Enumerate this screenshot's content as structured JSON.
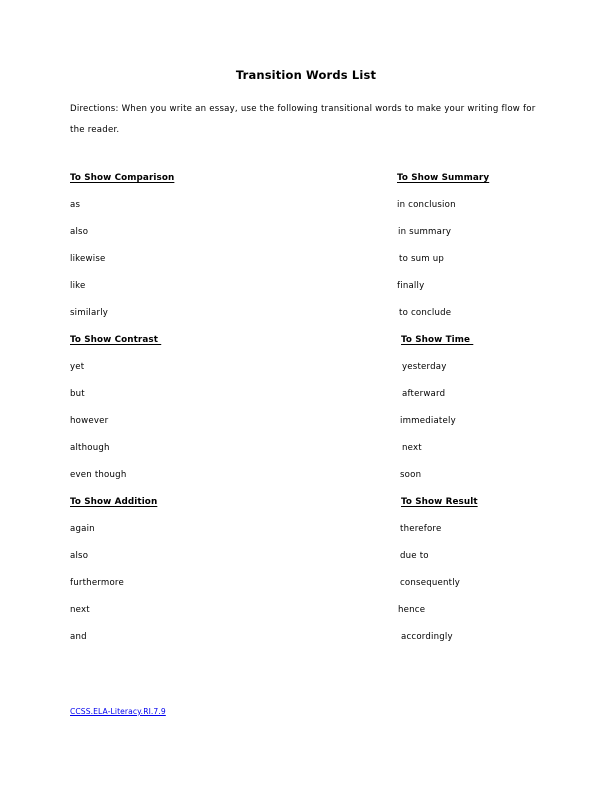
{
  "document": {
    "title": "Transition Words List",
    "directions": "Directions: When you write an essay, use the following transitional words to make your writing flow for the reader.",
    "link_color": "#0000ee",
    "text_color": "#000000",
    "background_color": "#ffffff"
  },
  "columns": {
    "left": [
      {
        "heading": "To Show Comparison",
        "indent": 0,
        "words": [
          {
            "text": "as",
            "indent": 0
          },
          {
            "text": "also",
            "indent": 0
          },
          {
            "text": "likewise",
            "indent": 0
          },
          {
            "text": "like",
            "indent": 0
          },
          {
            "text": "similarly",
            "indent": 0
          }
        ]
      },
      {
        "heading": "To Show Contrast ",
        "indent": 0,
        "words": [
          {
            "text": "yet",
            "indent": 0
          },
          {
            "text": "but",
            "indent": 0
          },
          {
            "text": "however",
            "indent": 0
          },
          {
            "text": "although",
            "indent": 0
          },
          {
            "text": "even though",
            "indent": 0
          }
        ]
      },
      {
        "heading": "To Show Addition",
        "indent": 0,
        "words": [
          {
            "text": "again",
            "indent": 0
          },
          {
            "text": "also",
            "indent": 0
          },
          {
            "text": "furthermore",
            "indent": 0
          },
          {
            "text": "next",
            "indent": 0
          },
          {
            "text": "and",
            "indent": 0
          }
        ]
      }
    ],
    "right": [
      {
        "heading": "To Show Summary",
        "indent": 0,
        "words": [
          {
            "text": "in conclusion",
            "indent": 0
          },
          {
            "text": "in summary",
            "indent": 1
          },
          {
            "text": "to sum up",
            "indent": 2
          },
          {
            "text": "finally",
            "indent": 0
          },
          {
            "text": "to conclude",
            "indent": 2
          }
        ]
      },
      {
        "heading": "To Show Time ",
        "indent": 4,
        "words": [
          {
            "text": "yesterday",
            "indent": 5
          },
          {
            "text": "afterward",
            "indent": 5
          },
          {
            "text": "immediately",
            "indent": 3
          },
          {
            "text": "next",
            "indent": 5
          },
          {
            "text": "soon",
            "indent": 3
          }
        ]
      },
      {
        "heading": "To Show Result",
        "indent": 4,
        "words": [
          {
            "text": "therefore",
            "indent": 3
          },
          {
            "text": "due to",
            "indent": 3
          },
          {
            "text": "consequently",
            "indent": 3
          },
          {
            "text": "hence",
            "indent": 1
          },
          {
            "text": "accordingly",
            "indent": 4
          }
        ]
      }
    ]
  },
  "footer": {
    "standard_link": "CCSS.ELA-Literacy.RI.7.9"
  }
}
